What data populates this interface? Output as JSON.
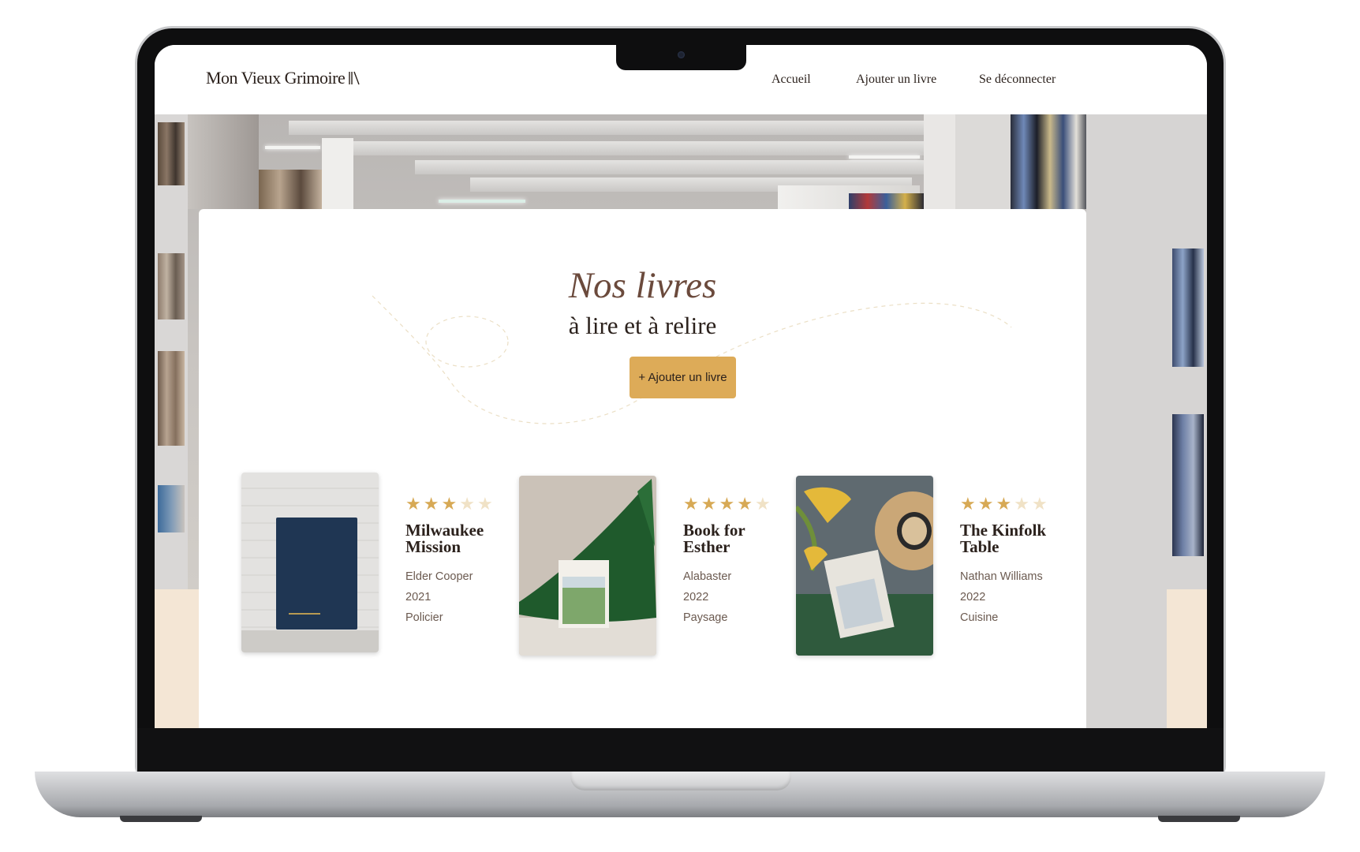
{
  "nav": {
    "logo": "Mon Vieux Grimoire",
    "links": [
      "Accueil",
      "Ajouter un livre",
      "Se déconnecter"
    ]
  },
  "hero": {
    "title": "Nos livres",
    "subtitle": "à lire et à relire",
    "add_button": "+ Ajouter un livre"
  },
  "books": [
    {
      "title_line1": "Milwaukee",
      "title_line2": "Mission",
      "author": "Elder Cooper",
      "year": "2021",
      "genre": "Policier",
      "rating": 3
    },
    {
      "title_line1": "Book for",
      "title_line2": "Esther",
      "author": "Alabaster",
      "year": "2022",
      "genre": "Paysage",
      "rating": 4
    },
    {
      "title_line1": "The Kinfolk",
      "title_line2": "Table",
      "author": "Nathan Williams",
      "year": "2022",
      "genre": "Cuisine",
      "rating": 3
    }
  ],
  "colors": {
    "accent": "#ddab58",
    "title": "#6b4a3c",
    "text": "#2b211c",
    "beige": "#f4e6d5"
  }
}
